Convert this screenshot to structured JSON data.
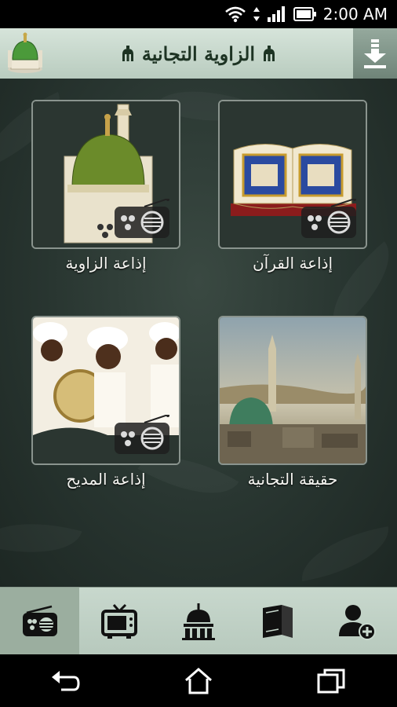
{
  "status_bar": {
    "time": "2:00 AM"
  },
  "app_bar": {
    "title": "الزاوية التجانية"
  },
  "tiles": [
    {
      "label": "إذاعة القرآن"
    },
    {
      "label": "إذاعة الزاوية"
    },
    {
      "label": "حقيقة التجانية"
    },
    {
      "label": "إذاعة المديح"
    }
  ],
  "tab_bar": {
    "tabs": [
      "radio-icon",
      "tv-icon",
      "mosque-icon",
      "books-icon",
      "add-user-icon"
    ],
    "active": "radio-icon"
  },
  "colors": {
    "app_bar": "#c8d8cd",
    "accent": "#1d3323",
    "background": "#283530"
  }
}
